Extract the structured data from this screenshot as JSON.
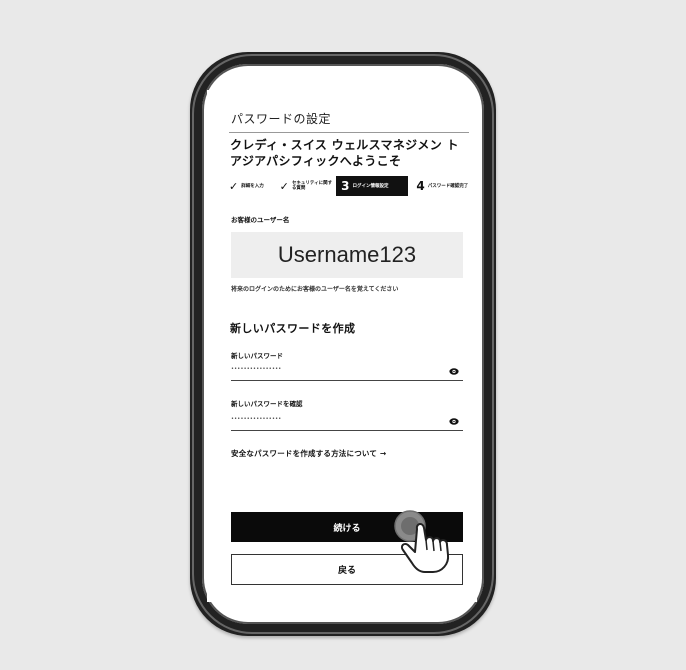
{
  "screen": {
    "title": "パスワードの設定",
    "welcome": "クレディ・スイス ウェルスマネジメン トアジアパシフィックへようこそ",
    "steps": [
      {
        "status": "done",
        "label": "詳細を入力"
      },
      {
        "status": "done",
        "label": "セキュリティに関する質問"
      },
      {
        "number": "3",
        "status": "active",
        "label": "ログイン情報設定"
      },
      {
        "number": "4",
        "status": "pending",
        "label": "パスワード確認完了"
      }
    ],
    "username_label": "お客様のユーザー名",
    "username_value": "Username123",
    "username_hint": "将来のログインのためにお客様のユーザー名を覚えてください",
    "create_password_heading": "新しいパスワードを作成",
    "new_password_label": "新しいパスワード",
    "new_password_value": "••••••••••••••••",
    "confirm_password_label": "新しいパスワードを確認",
    "confirm_password_value": "••••••••••••••••",
    "secure_password_link": "安全なパスワードを作成する方法について →",
    "continue_label": "続ける",
    "back_label": "戻る"
  }
}
